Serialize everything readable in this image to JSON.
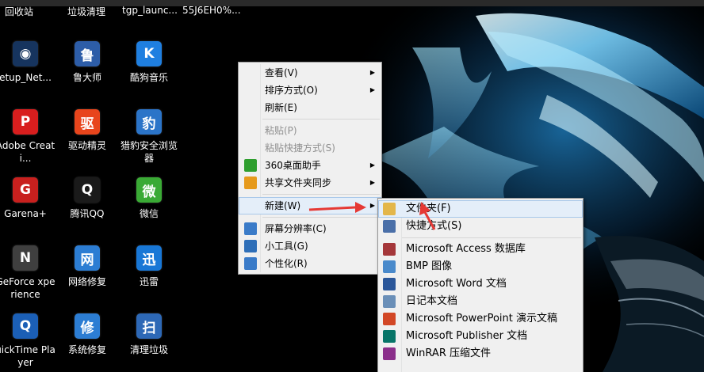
{
  "desktop": {
    "top_row": [
      "回收站",
      "垃圾清理",
      "tgp_launc...",
      "55J6EH0%..."
    ],
    "icons": [
      {
        "label": "etup_Net...",
        "icon": "setup-icon",
        "color": "#16345e"
      },
      {
        "label": "鲁大师",
        "icon": "ludashi-icon",
        "color": "#2d5da8"
      },
      {
        "label": "酷狗音乐",
        "icon": "kugou-icon",
        "color": "#1f7fe0"
      },
      {
        "label": "Adobe Creati...",
        "icon": "adobe-icon",
        "color": "#d81e1e"
      },
      {
        "label": "驱动精灵",
        "icon": "qudong-icon",
        "color": "#e8451c"
      },
      {
        "label": "猎豹安全浏览器",
        "icon": "liebao-icon",
        "color": "#2b74c8"
      },
      {
        "label": "Garena+",
        "icon": "garena-icon",
        "color": "#c8201e"
      },
      {
        "label": "腾讯QQ",
        "icon": "qq-icon",
        "color": "#1a1a1a"
      },
      {
        "label": "微信",
        "icon": "wechat-icon",
        "color": "#3aaa35"
      },
      {
        "label": "GeForce xperience",
        "icon": "geforce-icon",
        "color": "#3f3f3f"
      },
      {
        "label": "网络修复",
        "icon": "netrepair-icon",
        "color": "#2c7dd3"
      },
      {
        "label": "迅雷",
        "icon": "xunlei-icon",
        "color": "#1877d6"
      },
      {
        "label": "uickTime Player",
        "icon": "quicktime-icon",
        "color": "#1b5fb6"
      },
      {
        "label": "系统修复",
        "icon": "sysrepair-icon",
        "color": "#2c7dd3"
      },
      {
        "label": "清理垃圾",
        "icon": "cleanup-icon",
        "color": "#2d68b6"
      }
    ]
  },
  "context_menu": {
    "items": [
      {
        "label": "查看(V)",
        "arrow": true
      },
      {
        "label": "排序方式(O)",
        "arrow": true
      },
      {
        "label": "刷新(E)"
      },
      {
        "sep": true
      },
      {
        "label": "粘贴(P)",
        "disabled": true
      },
      {
        "label": "粘贴快捷方式(S)",
        "disabled": true
      },
      {
        "label": "360桌面助手",
        "arrow": true,
        "icon": "360-icon",
        "color": "#2e9e2e"
      },
      {
        "label": "共享文件夹同步",
        "arrow": true,
        "icon": "share-sync-icon",
        "color": "#e69a1c"
      },
      {
        "sep": true
      },
      {
        "label": "新建(W)",
        "arrow": true,
        "highlight": true
      },
      {
        "sep": true
      },
      {
        "label": "屏幕分辨率(C)",
        "icon": "monitor-icon",
        "color": "#3a7bc8"
      },
      {
        "label": "小工具(G)",
        "icon": "gadget-icon",
        "color": "#2f6fb8"
      },
      {
        "label": "个性化(R)",
        "icon": "personalize-icon",
        "color": "#3a7bc8"
      }
    ]
  },
  "new_submenu": {
    "items": [
      {
        "label": "文件夹(F)",
        "icon": "folder-icon",
        "color": "#e3b64a",
        "highlight": true
      },
      {
        "label": "快捷方式(S)",
        "icon": "shortcut-icon",
        "color": "#4a6fa8"
      },
      {
        "sep": true
      },
      {
        "label": "Microsoft Access 数据库",
        "icon": "access-icon",
        "color": "#a4373a"
      },
      {
        "label": "BMP 图像",
        "icon": "bmp-icon",
        "color": "#4a8acb"
      },
      {
        "label": "Microsoft Word 文档",
        "icon": "word-icon",
        "color": "#2b579a"
      },
      {
        "label": "日记本文档",
        "icon": "journal-icon",
        "color": "#6a8fb8"
      },
      {
        "label": "Microsoft PowerPoint 演示文稿",
        "icon": "powerpoint-icon",
        "color": "#d24726"
      },
      {
        "label": "Microsoft Publisher 文档",
        "icon": "publisher-icon",
        "color": "#077568"
      },
      {
        "label": "WinRAR 压缩文件",
        "icon": "winrar-icon",
        "color": "#8b2f8b"
      }
    ]
  },
  "colors": {
    "accent": "#e53935",
    "menu_bg": "#f0f0f0",
    "highlight": "#e4eef9"
  }
}
